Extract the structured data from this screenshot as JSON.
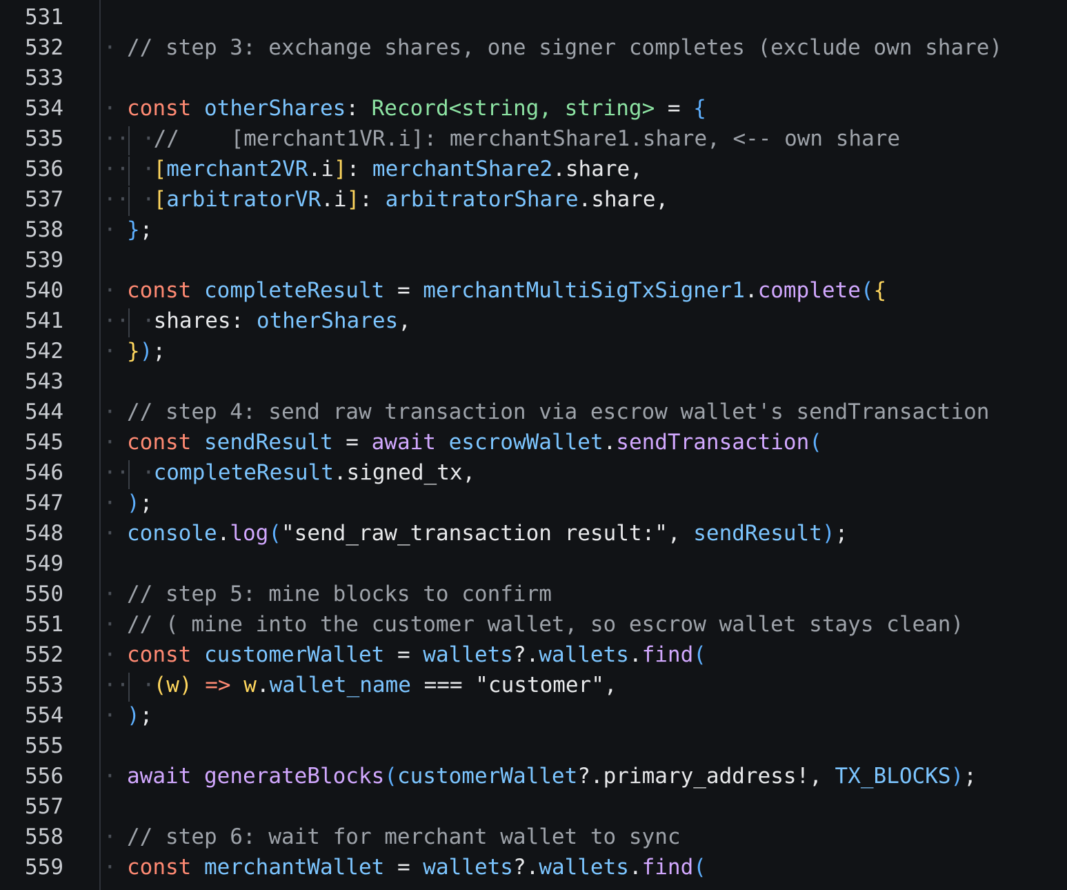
{
  "editor": {
    "language": "TypeScript",
    "colors": {
      "background": "#111316",
      "line_number": "#c9ccd1",
      "comment": "#9ea3aa",
      "keyword": "#ff8a73",
      "variable": "#7cc5ff",
      "type": "#8de3a3",
      "function": "#d2a8ff",
      "bracket_blue": "#5eb0ff",
      "bracket_yellow": "#ffd75e",
      "whitespace_marker": "#4b5058"
    },
    "lines": [
      {
        "n": "531",
        "tokens": []
      },
      {
        "n": "532",
        "tokens": [
          {
            "t": "comment",
            "v": "// step 3: exchange shares, one signer completes (exclude own share)"
          }
        ]
      },
      {
        "n": "533",
        "tokens": []
      },
      {
        "n": "534",
        "tokens": [
          {
            "t": "keyword",
            "v": "const"
          },
          {
            "t": "sp",
            "v": " "
          },
          {
            "t": "var",
            "v": "otherShares"
          },
          {
            "t": "punct",
            "v": ": "
          },
          {
            "t": "type",
            "v": "Record<string, string>"
          },
          {
            "t": "punct",
            "v": " = "
          },
          {
            "t": "brace",
            "v": "{"
          }
        ]
      },
      {
        "n": "535",
        "tokens": [
          {
            "t": "comment",
            "v": "//    [merchant1VR.i]: merchantShare1.share, <-- own share"
          }
        ]
      },
      {
        "n": "536",
        "tokens": [
          {
            "t": "brace2",
            "v": "["
          },
          {
            "t": "var",
            "v": "merchant2VR"
          },
          {
            "t": "punct",
            "v": ".i"
          },
          {
            "t": "brace2",
            "v": "]"
          },
          {
            "t": "punct",
            "v": ": "
          },
          {
            "t": "var",
            "v": "merchantShare2"
          },
          {
            "t": "punct",
            "v": ".share,"
          }
        ]
      },
      {
        "n": "537",
        "tokens": [
          {
            "t": "brace2",
            "v": "["
          },
          {
            "t": "var",
            "v": "arbitratorVR"
          },
          {
            "t": "punct",
            "v": ".i"
          },
          {
            "t": "brace2",
            "v": "]"
          },
          {
            "t": "punct",
            "v": ": "
          },
          {
            "t": "var",
            "v": "arbitratorShare"
          },
          {
            "t": "punct",
            "v": ".share,"
          }
        ]
      },
      {
        "n": "538",
        "tokens": [
          {
            "t": "brace",
            "v": "}"
          },
          {
            "t": "punct",
            "v": ";"
          }
        ]
      },
      {
        "n": "539",
        "tokens": []
      },
      {
        "n": "540",
        "tokens": [
          {
            "t": "keyword",
            "v": "const"
          },
          {
            "t": "sp",
            "v": " "
          },
          {
            "t": "var",
            "v": "completeResult"
          },
          {
            "t": "punct",
            "v": " = "
          },
          {
            "t": "var",
            "v": "merchantMultiSigTxSigner1"
          },
          {
            "t": "punct",
            "v": "."
          },
          {
            "t": "func",
            "v": "complete"
          },
          {
            "t": "brace",
            "v": "("
          },
          {
            "t": "brace2",
            "v": "{"
          }
        ]
      },
      {
        "n": "541",
        "tokens": [
          {
            "t": "punct",
            "v": "shares: "
          },
          {
            "t": "var",
            "v": "otherShares"
          },
          {
            "t": "punct",
            "v": ","
          }
        ]
      },
      {
        "n": "542",
        "tokens": [
          {
            "t": "brace2",
            "v": "}"
          },
          {
            "t": "brace",
            "v": ")"
          },
          {
            "t": "punct",
            "v": ";"
          }
        ]
      },
      {
        "n": "543",
        "tokens": []
      },
      {
        "n": "544",
        "tokens": [
          {
            "t": "comment",
            "v": "// step 4: send raw transaction via escrow wallet's sendTransaction"
          }
        ]
      },
      {
        "n": "545",
        "tokens": [
          {
            "t": "keyword",
            "v": "const"
          },
          {
            "t": "sp",
            "v": " "
          },
          {
            "t": "var",
            "v": "sendResult"
          },
          {
            "t": "punct",
            "v": " = "
          },
          {
            "t": "func",
            "v": "await"
          },
          {
            "t": "sp",
            "v": " "
          },
          {
            "t": "var",
            "v": "escrowWallet"
          },
          {
            "t": "punct",
            "v": "."
          },
          {
            "t": "func",
            "v": "sendTransaction"
          },
          {
            "t": "brace",
            "v": "("
          }
        ]
      },
      {
        "n": "546",
        "tokens": [
          {
            "t": "var",
            "v": "completeResult"
          },
          {
            "t": "punct",
            "v": ".signed_tx,"
          }
        ]
      },
      {
        "n": "547",
        "tokens": [
          {
            "t": "brace",
            "v": ")"
          },
          {
            "t": "punct",
            "v": ";"
          }
        ]
      },
      {
        "n": "548",
        "tokens": [
          {
            "t": "var",
            "v": "console"
          },
          {
            "t": "punct",
            "v": "."
          },
          {
            "t": "func",
            "v": "log"
          },
          {
            "t": "brace",
            "v": "("
          },
          {
            "t": "str",
            "v": "\"send_raw_transaction result:\""
          },
          {
            "t": "punct",
            "v": ", "
          },
          {
            "t": "var",
            "v": "sendResult"
          },
          {
            "t": "brace",
            "v": ")"
          },
          {
            "t": "punct",
            "v": ";"
          }
        ]
      },
      {
        "n": "549",
        "tokens": []
      },
      {
        "n": "550",
        "tokens": [
          {
            "t": "comment",
            "v": "// step 5: mine blocks to confirm"
          }
        ]
      },
      {
        "n": "551",
        "tokens": [
          {
            "t": "comment",
            "v": "// ( mine into the customer wallet, so escrow wallet stays clean)"
          }
        ]
      },
      {
        "n": "552",
        "tokens": [
          {
            "t": "keyword",
            "v": "const"
          },
          {
            "t": "sp",
            "v": " "
          },
          {
            "t": "var",
            "v": "customerWallet"
          },
          {
            "t": "punct",
            "v": " = "
          },
          {
            "t": "var",
            "v": "wallets"
          },
          {
            "t": "punct",
            "v": "?."
          },
          {
            "t": "var",
            "v": "wallets"
          },
          {
            "t": "punct",
            "v": "."
          },
          {
            "t": "func",
            "v": "find"
          },
          {
            "t": "brace",
            "v": "("
          }
        ]
      },
      {
        "n": "553",
        "tokens": [
          {
            "t": "param",
            "v": "(w)"
          },
          {
            "t": "punct",
            "v": " "
          },
          {
            "t": "keyword",
            "v": "=>"
          },
          {
            "t": "punct",
            "v": " "
          },
          {
            "t": "param",
            "v": "w"
          },
          {
            "t": "punct",
            "v": "."
          },
          {
            "t": "var",
            "v": "wallet_name"
          },
          {
            "t": "punct",
            "v": " === "
          },
          {
            "t": "str",
            "v": "\"customer\""
          },
          {
            "t": "punct",
            "v": ","
          }
        ]
      },
      {
        "n": "554",
        "tokens": [
          {
            "t": "brace",
            "v": ")"
          },
          {
            "t": "punct",
            "v": ";"
          }
        ]
      },
      {
        "n": "555",
        "tokens": []
      },
      {
        "n": "556",
        "tokens": [
          {
            "t": "func",
            "v": "await"
          },
          {
            "t": "sp",
            "v": " "
          },
          {
            "t": "func",
            "v": "generateBlocks"
          },
          {
            "t": "brace",
            "v": "("
          },
          {
            "t": "var",
            "v": "customerWallet"
          },
          {
            "t": "punct",
            "v": "?.primary_address!, "
          },
          {
            "t": "const",
            "v": "TX_BLOCKS"
          },
          {
            "t": "brace",
            "v": ")"
          },
          {
            "t": "punct",
            "v": ";"
          }
        ]
      },
      {
        "n": "557",
        "tokens": []
      },
      {
        "n": "558",
        "tokens": [
          {
            "t": "comment",
            "v": "// step 6: wait for merchant wallet to sync"
          }
        ]
      },
      {
        "n": "559",
        "tokens": [
          {
            "t": "keyword",
            "v": "const"
          },
          {
            "t": "sp",
            "v": " "
          },
          {
            "t": "var",
            "v": "merchantWallet"
          },
          {
            "t": "punct",
            "v": " = "
          },
          {
            "t": "var",
            "v": "wallets"
          },
          {
            "t": "punct",
            "v": "?."
          },
          {
            "t": "var",
            "v": "wallets"
          },
          {
            "t": "punct",
            "v": "."
          },
          {
            "t": "func",
            "v": "find"
          },
          {
            "t": "brace",
            "v": "("
          }
        ]
      }
    ]
  }
}
